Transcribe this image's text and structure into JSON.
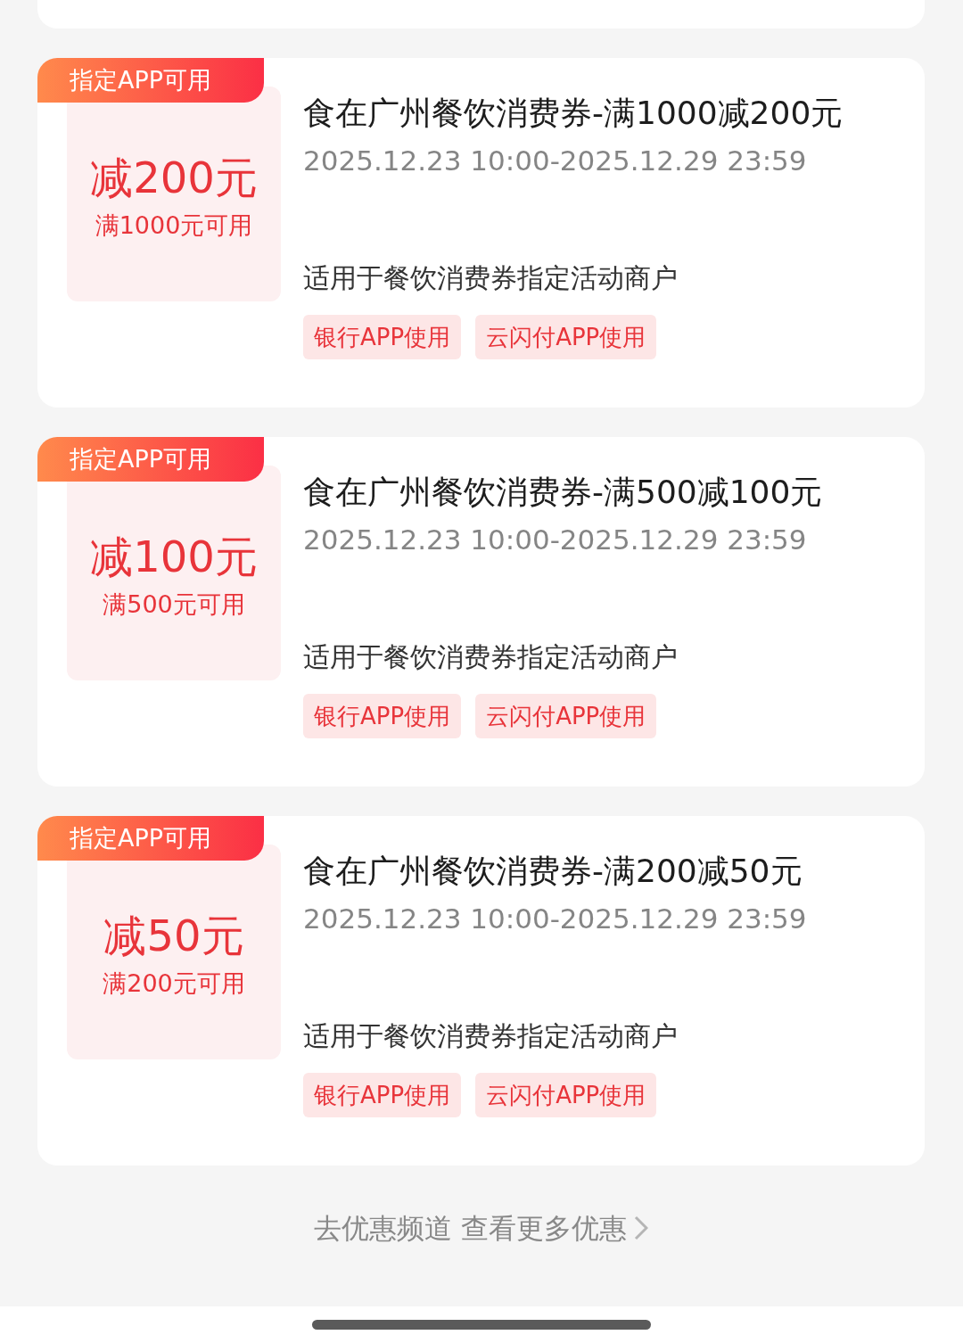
{
  "coupons": [
    {
      "badge": "指定APP可用",
      "amount": "减200元",
      "condition": "满1000元可用",
      "title": "食在广州餐饮消费券-满1000减200元",
      "validity": "2025.12.23 10:00-2025.12.29 23:59",
      "scope": "适用于餐饮消费券指定活动商户",
      "tags": [
        "银行APP使用",
        "云闪付APP使用"
      ]
    },
    {
      "badge": "指定APP可用",
      "amount": "减100元",
      "condition": "满500元可用",
      "title": "食在广州餐饮消费券-满500减100元",
      "validity": "2025.12.23 10:00-2025.12.29 23:59",
      "scope": "适用于餐饮消费券指定活动商户",
      "tags": [
        "银行APP使用",
        "云闪付APP使用"
      ]
    },
    {
      "badge": "指定APP可用",
      "amount": "减50元",
      "condition": "满200元可用",
      "title": "食在广州餐饮消费券-满200减50元",
      "validity": "2025.12.23 10:00-2025.12.29 23:59",
      "scope": "适用于餐饮消费券指定活动商户",
      "tags": [
        "银行APP使用",
        "云闪付APP使用"
      ]
    }
  ],
  "more_link": "去优惠频道 查看更多优惠"
}
